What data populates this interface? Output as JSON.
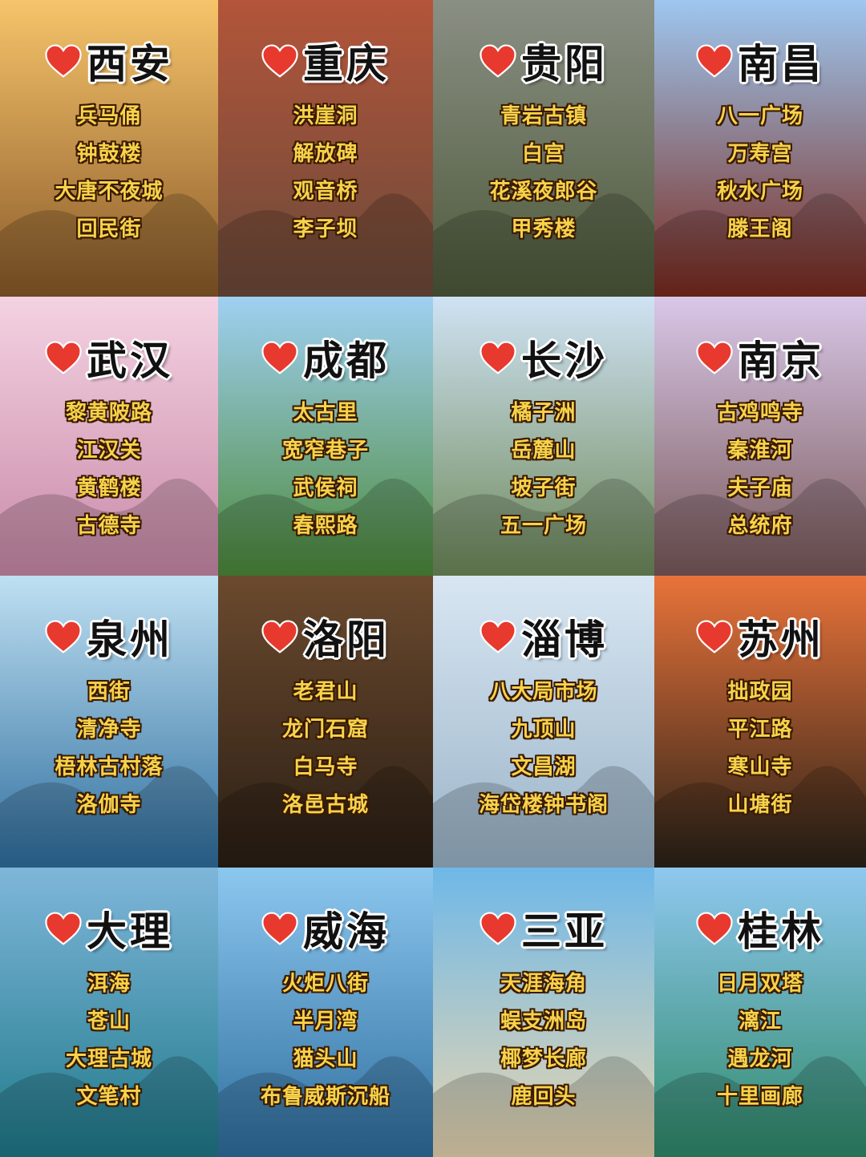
{
  "colors": {
    "heart": "#e8392f",
    "spot_text": "#f7d24b",
    "city_text": "#111111"
  },
  "cities": [
    {
      "name": "西安",
      "spots": [
        "兵马俑",
        "钟鼓楼",
        "大唐不夜城",
        "回民街"
      ],
      "bg": [
        "#f6c46a",
        "#8a5a2a"
      ]
    },
    {
      "name": "重庆",
      "spots": [
        "洪崖洞",
        "解放碑",
        "观音桥",
        "李子坝"
      ],
      "bg": [
        "#b3553a",
        "#6b4a3a"
      ]
    },
    {
      "name": "贵阳",
      "spots": [
        "青岩古镇",
        "白宫",
        "花溪夜郎谷",
        "甲秀楼"
      ],
      "bg": [
        "#8a8f84",
        "#4d5a3a"
      ]
    },
    {
      "name": "南昌",
      "spots": [
        "八一广场",
        "万寿宫",
        "秋水广场",
        "滕王阁"
      ],
      "bg": [
        "#9ec7f0",
        "#7a2a1e"
      ]
    },
    {
      "name": "武汉",
      "spots": [
        "黎黄陂路",
        "江汉关",
        "黄鹤楼",
        "古德寺"
      ],
      "bg": [
        "#f4d2e2",
        "#c98aa8"
      ]
    },
    {
      "name": "成都",
      "spots": [
        "太古里",
        "宽窄巷子",
        "武侯祠",
        "春熙路"
      ],
      "bg": [
        "#9fd0f2",
        "#4d8a3a"
      ]
    },
    {
      "name": "长沙",
      "spots": [
        "橘子洲",
        "岳麓山",
        "坡子街",
        "五一广场"
      ],
      "bg": [
        "#cfe2f4",
        "#6f8a5a"
      ]
    },
    {
      "name": "南京",
      "spots": [
        "古鸡鸣寺",
        "秦淮河",
        "夫子庙",
        "总统府"
      ],
      "bg": [
        "#d9c7e8",
        "#7a5a5a"
      ]
    },
    {
      "name": "泉州",
      "spots": [
        "西街",
        "清净寺",
        "梧林古村落",
        "洛伽寺"
      ],
      "bg": [
        "#bfe0f2",
        "#2f6f9f"
      ]
    },
    {
      "name": "洛阳",
      "spots": [
        "老君山",
        "龙门石窟",
        "白马寺",
        "洛邑古城"
      ],
      "bg": [
        "#6b4a2e",
        "#2a1e14"
      ]
    },
    {
      "name": "淄博",
      "spots": [
        "八大局市场",
        "九顶山",
        "文昌湖",
        "海岱楼钟书阁"
      ],
      "bg": [
        "#d8e6f2",
        "#9ab4c8"
      ]
    },
    {
      "name": "苏州",
      "spots": [
        "拙政园",
        "平江路",
        "寒山寺",
        "山塘街"
      ],
      "bg": [
        "#e9733a",
        "#2a2218"
      ]
    },
    {
      "name": "大理",
      "spots": [
        "洱海",
        "苍山",
        "大理古城",
        "文笔村"
      ],
      "bg": [
        "#7fb6da",
        "#1f7a8a"
      ]
    },
    {
      "name": "威海",
      "spots": [
        "火炬八街",
        "半月湾",
        "猫头山",
        "布鲁威斯沉船"
      ],
      "bg": [
        "#8cc7ef",
        "#2f6f9f"
      ]
    },
    {
      "name": "三亚",
      "spots": [
        "天涯海角",
        "蜈支洲岛",
        "椰梦长廊",
        "鹿回头"
      ],
      "bg": [
        "#6fb8e8",
        "#e8d6b0"
      ]
    },
    {
      "name": "桂林",
      "spots": [
        "日月双塔",
        "漓江",
        "遇龙河",
        "十里画廊"
      ],
      "bg": [
        "#8fc8ef",
        "#2f8a6a"
      ]
    }
  ]
}
